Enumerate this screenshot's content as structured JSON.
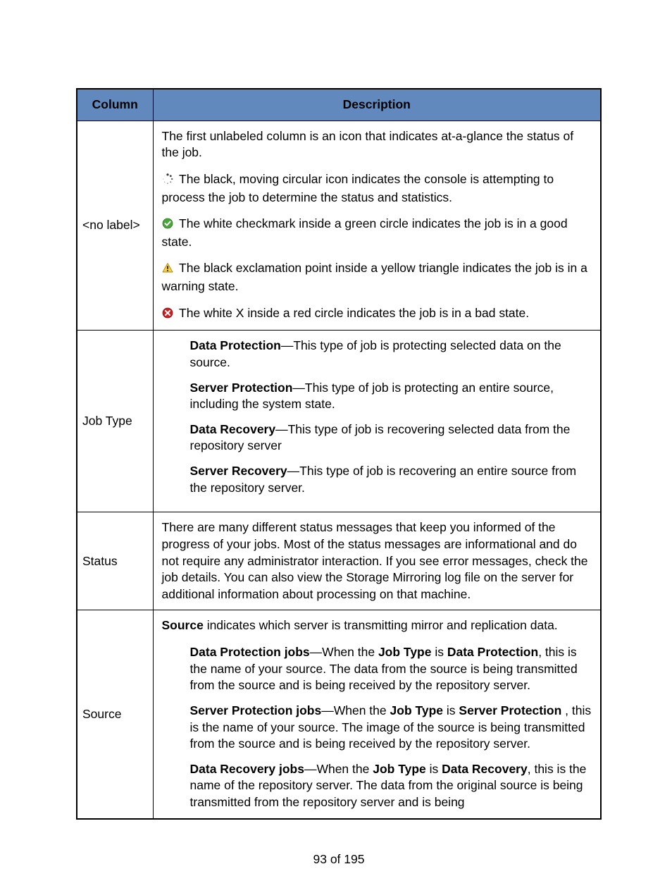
{
  "table": {
    "headers": {
      "col1": "Column",
      "col2": "Description"
    },
    "rows": {
      "no_label": {
        "label": "<no label>",
        "intro": "The first unlabeled column is an icon that indicates at-a-glance the status of the job.",
        "spinner_desc": " The black, moving circular icon indicates the console is attempting to process the job to determine the status and statistics.",
        "check_desc": " The white checkmark inside a green circle indicates the job is in a good state.",
        "warn_desc": " The black exclamation point inside a yellow triangle indicates the job is in a warning state.",
        "error_desc": " The white X inside a red circle indicates the job is in a bad state."
      },
      "job_type": {
        "label": "Job Type",
        "items": [
          {
            "term": "Data Protection",
            "desc": "—This type of job is protecting selected data on the source."
          },
          {
            "term": "Server Protection",
            "desc": "—This type of job is protecting an entire source, including the system state."
          },
          {
            "term": "Data Recovery",
            "desc": "—This type of job is recovering selected data from the repository server"
          },
          {
            "term": "Server Recovery",
            "desc": "—This type of job is recovering an entire source from the repository server."
          }
        ]
      },
      "status": {
        "label": "Status",
        "desc": "There are many different status messages that keep you informed of the progress of your jobs. Most of the status messages are informational and do not require any administrator interaction. If you see error messages, check the job details. You can also view the Storage Mirroring log file on the server for additional information about processing on that machine."
      },
      "source": {
        "label": "Source",
        "intro_b": "Source",
        "intro_rest": " indicates which server is transmitting mirror and replication data.",
        "items": {
          "dp": {
            "t1": "Data Protection jobs",
            "mid1": "—When the ",
            "t2": "Job Type",
            "mid2": " is ",
            "t3": "Data Protection",
            "rest": ", this is the name of your source. The data from the source is being transmitted from the source and is being received by the repository server."
          },
          "sp": {
            "t1": "Server Protection jobs",
            "mid1": "—When the ",
            "t2": "Job Type",
            "mid2": " is ",
            "t3": "Server Protection",
            "rest": " , this is the name of your source. The image of the source is being transmitted from the source and is being received by the repository server."
          },
          "dr": {
            "t1": "Data Recovery jobs",
            "mid1": "—When the ",
            "t2": "Job Type",
            "mid2": " is ",
            "t3": "Data Recovery",
            "rest": ", this is the name of the repository server. The data from the original source is being transmitted from the repository server and is being"
          }
        }
      }
    }
  },
  "footer": "93 of 195"
}
